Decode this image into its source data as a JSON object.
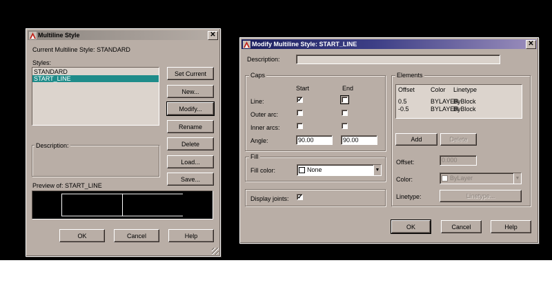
{
  "dialog1": {
    "title": "Multiline Style",
    "current_style_label": "Current Multiline Style:",
    "current_style_value": "STANDARD",
    "styles_label": "Styles:",
    "styles": [
      "STANDARD",
      "START_LINE"
    ],
    "selected_style_index": 1,
    "buttons": {
      "set_current": "Set Current",
      "new": "New...",
      "modify": "Modify...",
      "rename": "Rename",
      "delete": "Delete",
      "load": "Load...",
      "save": "Save..."
    },
    "description_label": "Description:",
    "preview_label": "Preview of:",
    "preview_value": "START_LINE",
    "ok": "OK",
    "cancel": "Cancel",
    "help": "Help"
  },
  "dialog2": {
    "title": "Modify Multiline Style: START_LINE",
    "description_label": "Description:",
    "description_value": "",
    "caps": {
      "title": "Caps",
      "start_header": "Start",
      "end_header": "End",
      "line_label": "Line:",
      "outer_arc_label": "Outer arc:",
      "inner_arcs_label": "Inner arcs:",
      "angle_label": "Angle:",
      "line_start_checked": true,
      "line_end_checked": false,
      "outer_start_checked": false,
      "outer_end_checked": false,
      "inner_start_checked": false,
      "inner_end_checked": false,
      "angle_start": "90.00",
      "angle_end": "90.00"
    },
    "fill": {
      "title": "Fill",
      "color_label": "Fill color:",
      "color_value": "None"
    },
    "display_joints_label": "Display joints:",
    "display_joints_checked": true,
    "elements": {
      "title": "Elements",
      "headers": [
        "Offset",
        "Color",
        "Linetype"
      ],
      "rows": [
        [
          "0.5",
          "BYLAYER",
          "ByBlock"
        ],
        [
          "-0.5",
          "BYLAYER",
          "ByBlock"
        ]
      ],
      "add": "Add",
      "delete": "Delete",
      "offset_label": "Offset:",
      "offset_value": "0.000",
      "color_label": "Color:",
      "color_value": "ByLayer",
      "linetype_label": "Linetype:",
      "linetype_button": "Linetype..."
    },
    "ok": "OK",
    "cancel": "Cancel",
    "help": "Help"
  },
  "check_glyph": "✓",
  "close_glyph": "✕",
  "dropdown_glyph": "▼",
  "colors": {
    "dialog_bg": "#b9aea6",
    "selection": "#1f8c8a",
    "title_active": "#1c1f5e",
    "title_inactive": "#8d8680"
  }
}
